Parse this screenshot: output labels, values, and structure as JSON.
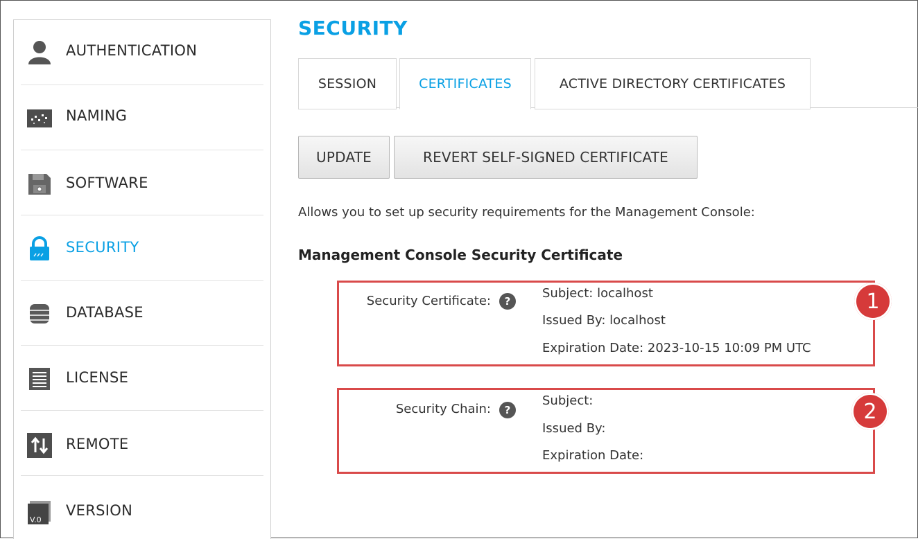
{
  "page": {
    "title": "SECURITY"
  },
  "sidebar": {
    "items": [
      {
        "label": "AUTHENTICATION",
        "icon": "user-icon"
      },
      {
        "label": "NAMING",
        "icon": "naming-icon"
      },
      {
        "label": "SOFTWARE",
        "icon": "floppy-disk-icon"
      },
      {
        "label": "SECURITY",
        "icon": "lock-icon",
        "active": true
      },
      {
        "label": "DATABASE",
        "icon": "database-icon"
      },
      {
        "label": "LICENSE",
        "icon": "document-icon"
      },
      {
        "label": "REMOTE",
        "icon": "updown-arrows-icon"
      },
      {
        "label": "VERSION",
        "icon": "version-icon"
      }
    ]
  },
  "tabs": [
    {
      "label": "SESSION"
    },
    {
      "label": "CERTIFICATES",
      "active": true
    },
    {
      "label": "ACTIVE DIRECTORY CERTIFICATES"
    }
  ],
  "toolbar": {
    "update_label": "UPDATE",
    "revert_label": "REVERT SELF-SIGNED CERTIFICATE"
  },
  "content": {
    "description": "Allows you to set up security requirements for the Management Console:",
    "section_title": "Management Console Security Certificate",
    "certificate": {
      "label": "Security Certificate:",
      "subject": "Subject: localhost",
      "issued_by": "Issued By: localhost",
      "expiration": "Expiration Date: 2023-10-15 10:09 PM UTC",
      "badge": "1"
    },
    "chain": {
      "label": "Security Chain:",
      "subject": "Subject:",
      "issued_by": "Issued By:",
      "expiration": "Expiration Date:",
      "badge": "2"
    },
    "help_glyph": "?"
  },
  "colors": {
    "accent": "#0aa0e4",
    "annotation_red": "#d94a4a",
    "badge_red": "#d63a3a"
  }
}
